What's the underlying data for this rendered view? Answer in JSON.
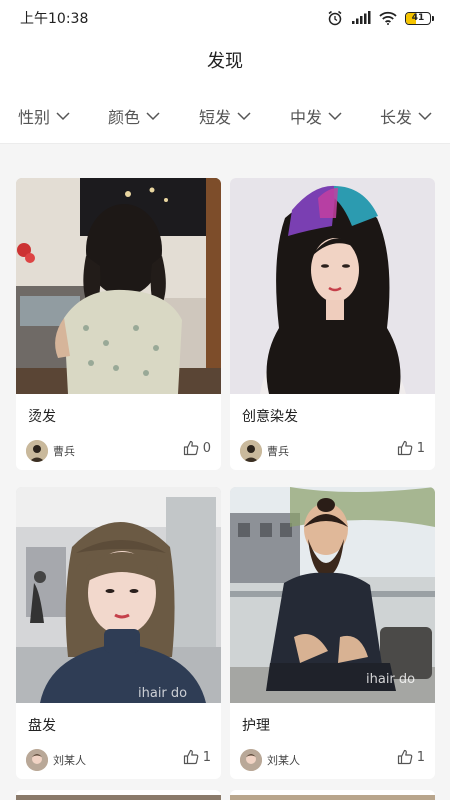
{
  "status_bar": {
    "time": "上午10:38",
    "battery_level": "41"
  },
  "header": {
    "title": "发现"
  },
  "filters": [
    {
      "label": "性别"
    },
    {
      "label": "颜色"
    },
    {
      "label": "短发"
    },
    {
      "label": "中发"
    },
    {
      "label": "长发"
    }
  ],
  "cards": [
    {
      "title": "烫发",
      "author": "曹兵",
      "likes": "0"
    },
    {
      "title": "创意染发",
      "author": "曹兵",
      "likes": "1"
    },
    {
      "title": "盘发",
      "author": "刘某人",
      "likes": "1"
    },
    {
      "title": "护理",
      "author": "刘某人",
      "likes": "1"
    }
  ],
  "watermark": "ihair do"
}
